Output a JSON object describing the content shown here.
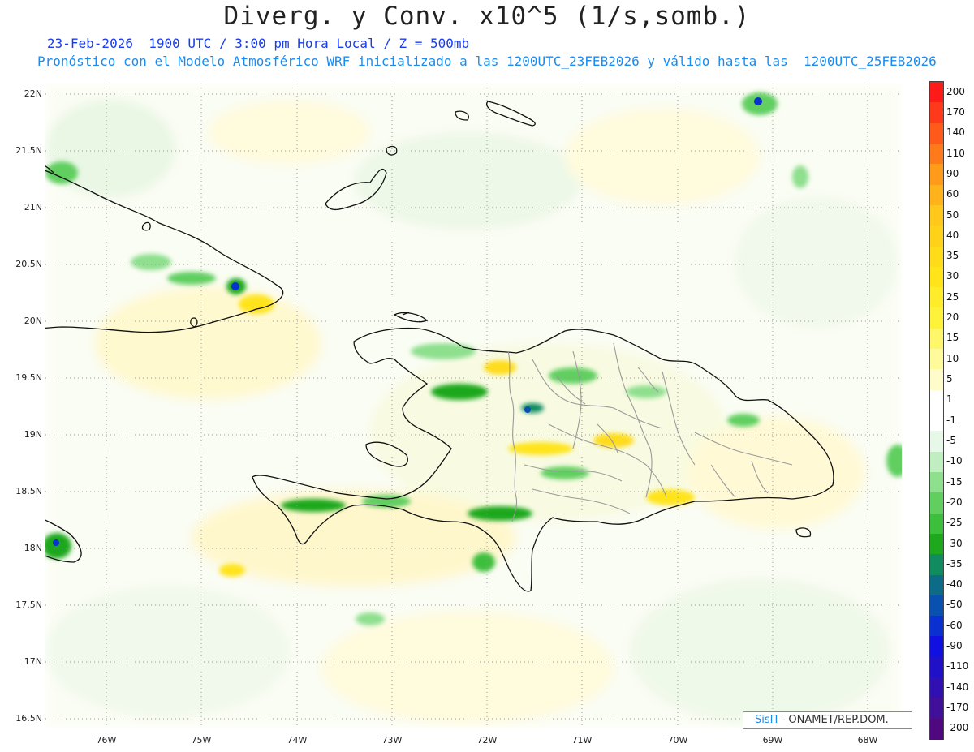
{
  "title": "Diverg. y Conv. x10^5 (1/s,somb.)",
  "subtitle_line1": "23-Feb-2026  1900 UTC / 3:00 pm Hora Local / Z = 500mb",
  "subtitle_line2": "Pronóstico con el Modelo Atmosférico WRF inicializado a las 1200UTC_23FEB2026 y válido hasta las  1200UTC_25FEB2026",
  "lat_labels": [
    "22N",
    "21.5N",
    "21N",
    "20.5N",
    "20N",
    "19.5N",
    "19N",
    "18.5N",
    "18N",
    "17.5N",
    "17N",
    "16.5N"
  ],
  "lon_labels": [
    "76W",
    "75W",
    "74W",
    "73W",
    "72W",
    "71W",
    "70W",
    "69W",
    "68W"
  ],
  "colorbar": {
    "labels": [
      "200",
      "170",
      "140",
      "110",
      "90",
      "60",
      "50",
      "40",
      "35",
      "30",
      "25",
      "20",
      "15",
      "10",
      "5",
      "1",
      "-1",
      "-5",
      "-10",
      "-15",
      "-20",
      "-25",
      "-30",
      "-35",
      "-40",
      "-50",
      "-60",
      "-90",
      "-110",
      "-140",
      "-170",
      "-200"
    ],
    "colors": [
      "#ff1a1a",
      "#ff3a1a",
      "#ff5a1a",
      "#ff7a1a",
      "#ff9a1a",
      "#ffb21a",
      "#ffc81a",
      "#ffd21a",
      "#ffdc1a",
      "#ffe41a",
      "#ffec2a",
      "#fff23a",
      "#fff66a",
      "#fffa9a",
      "#fffccc",
      "#ffffff",
      "#ffffff",
      "#e8f8e8",
      "#c0eec0",
      "#8edf8e",
      "#60cf60",
      "#3cbf3c",
      "#1ea81e",
      "#108c60",
      "#0c6c88",
      "#0a50b0",
      "#0a30d0",
      "#1010e0",
      "#2010c8",
      "#3010b0",
      "#40109a",
      "#500880"
    ]
  },
  "credit": {
    "brand": "SisΠ",
    "text": "- ONAMET/REP.DOM."
  }
}
